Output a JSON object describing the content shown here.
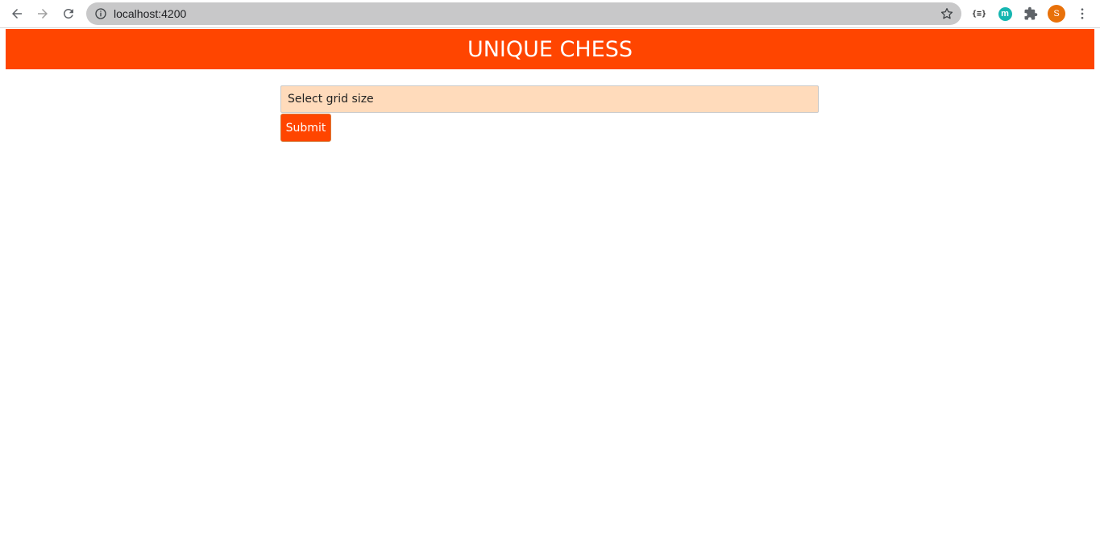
{
  "browser": {
    "url": "localhost:4200",
    "profile_initial": "S",
    "extension_json_label": "{≡}",
    "extension_m_label": "m"
  },
  "app": {
    "title": "UNIQUE CHESS",
    "accent_color": "#ff4500",
    "input_bg_color": "#ffdbbb"
  },
  "form": {
    "grid_select_placeholder": "Select grid size",
    "submit_label": "Submit"
  }
}
